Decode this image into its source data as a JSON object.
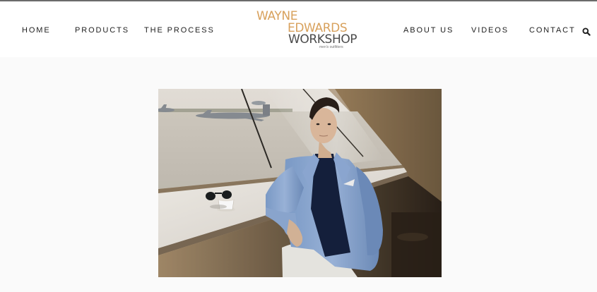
{
  "nav": {
    "home": "HOME",
    "products": "PRODUCTS",
    "process": "THE PROCESS",
    "about": "ABOUT US",
    "videos": "VIDEOS",
    "contact": "CONTACT"
  },
  "logo": {
    "line1": "WAYNE",
    "line2": "EDWARDS",
    "line3": "WORKSHOP",
    "tagline": "men's outfitters"
  },
  "icons": {
    "search": "search-icon"
  },
  "colors": {
    "logo_gold": "#d8a15c",
    "logo_gray": "#4b4b4b",
    "nav_text": "#1e1e1e",
    "header_bg": "#ffffff",
    "page_bg": "#fafafa",
    "top_rule": "#6b6b6b"
  }
}
